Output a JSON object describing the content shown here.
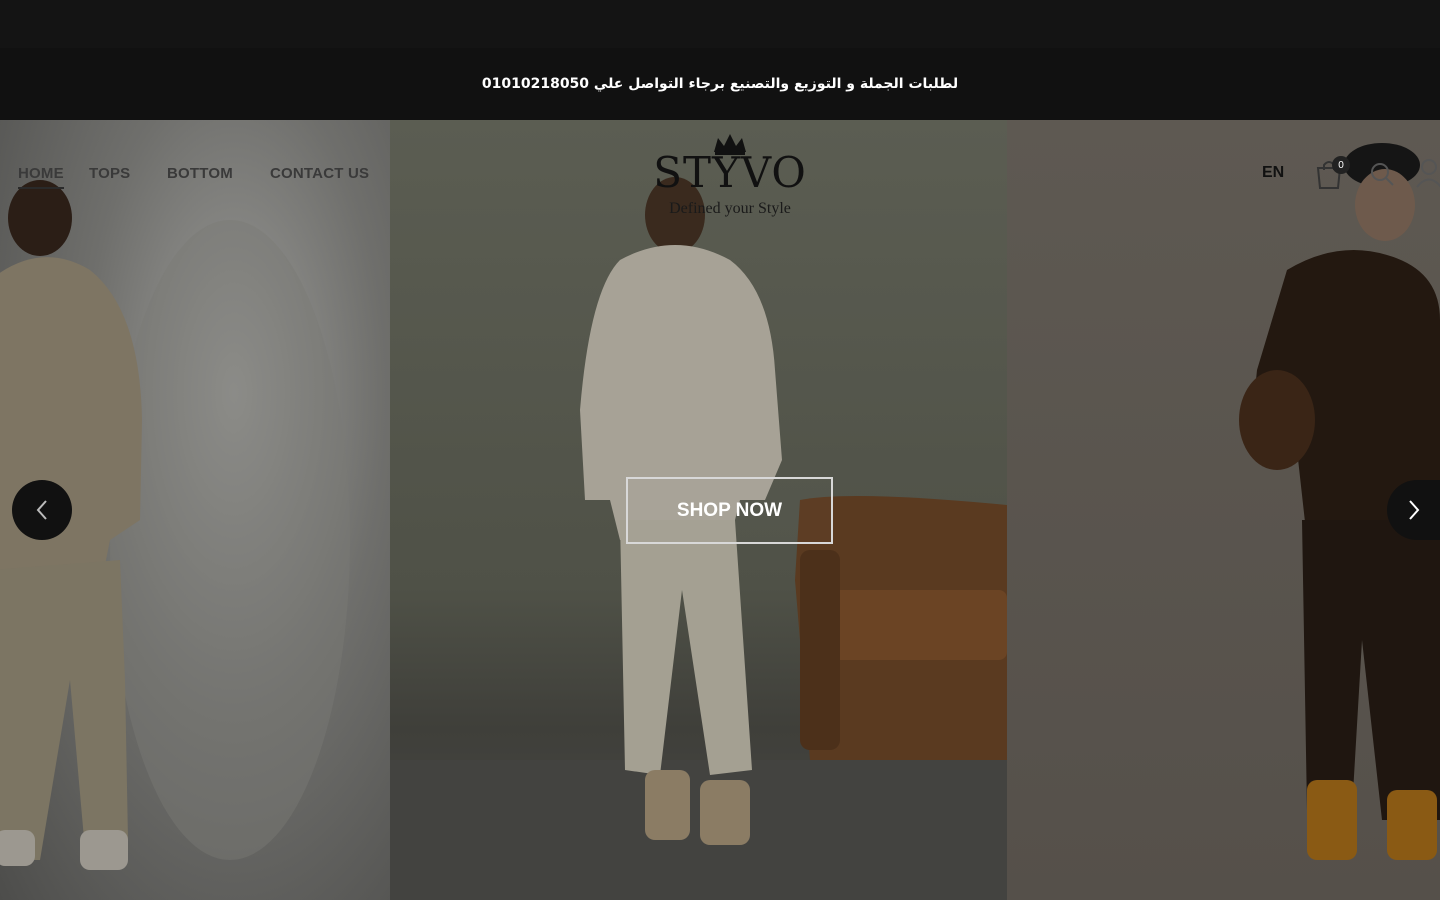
{
  "announcement": {
    "text": "لطلبات الجملة و التوزيع والتصنيع برجاء التواصل علي 01010218050"
  },
  "nav": {
    "items": [
      {
        "label": "HOME"
      },
      {
        "label": "TOPS"
      },
      {
        "label": "BOTTOM"
      },
      {
        "label": "CONTACT US"
      }
    ]
  },
  "logo": {
    "wordmark": "STYVO",
    "tagline": "Defined your Style"
  },
  "header_actions": {
    "language": "EN",
    "cart_count": "0",
    "icons": [
      "cart-icon",
      "search-icon",
      "user-icon"
    ]
  },
  "hero": {
    "cta_label": "SHOP NOW",
    "prev_icon": "chevron-left-icon",
    "next_icon": "chevron-right-icon"
  }
}
